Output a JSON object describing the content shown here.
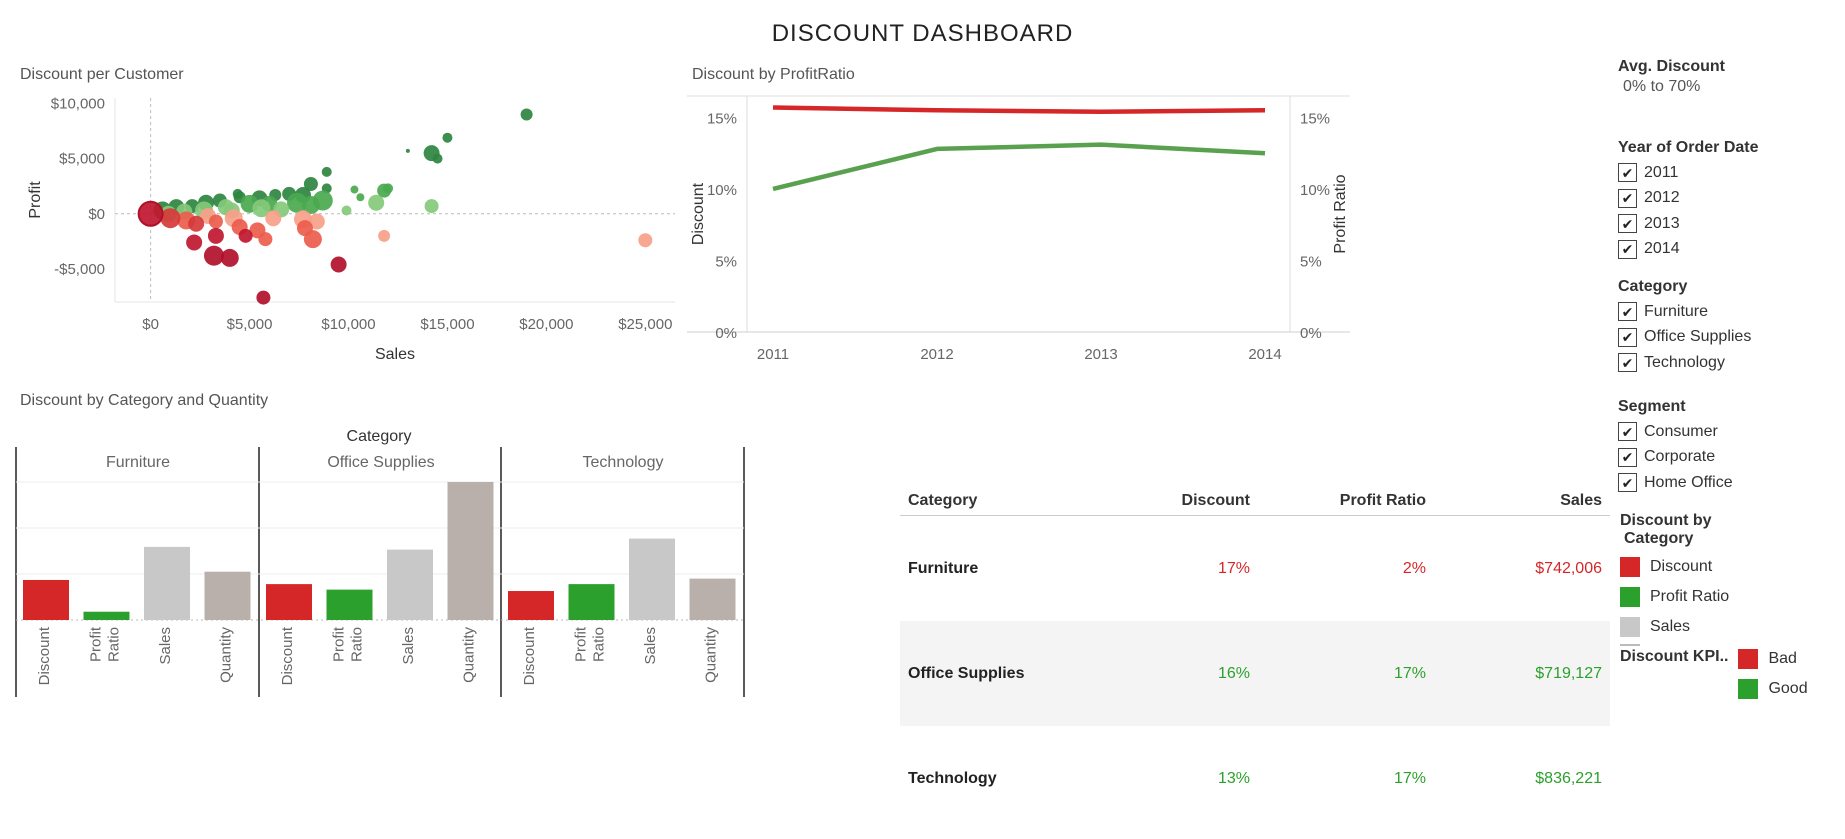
{
  "dashboard_title": "DISCOUNT DASHBOARD",
  "colors": {
    "bad": "#d62728",
    "good": "#2ca02c",
    "sales": "#c8c8c8",
    "quantity": "#bab0ab",
    "profit_line": "#59a14f",
    "discount_line": "#d62728"
  },
  "filters": {
    "avg_discount": {
      "title": "Avg. Discount",
      "value": "0% to 70%"
    },
    "year": {
      "title": "Year of Order Date",
      "items": [
        "2011",
        "2012",
        "2013",
        "2014"
      ]
    },
    "category": {
      "title": "Category",
      "items": [
        "Furniture",
        "Office Supplies",
        "Technology"
      ]
    },
    "segment": {
      "title": "Segment",
      "items": [
        "Consumer",
        "Corporate",
        "Home Office"
      ]
    }
  },
  "legend_category": {
    "title_line1": "Discount by",
    "title_line2": "Category",
    "items": [
      {
        "label": "Discount",
        "color": "#d62728"
      },
      {
        "label": "Profit Ratio",
        "color": "#2ca02c"
      },
      {
        "label": "Sales",
        "color": "#c8c8c8"
      }
    ]
  },
  "legend_kpi": {
    "title": "Discount KPI..",
    "items": [
      {
        "label": "Bad",
        "color": "#d62728"
      },
      {
        "label": "Good",
        "color": "#2ca02c"
      }
    ]
  },
  "table": {
    "headers": [
      "Category",
      "Discount",
      "Profit Ratio",
      "Sales"
    ],
    "rows": [
      {
        "category": "Furniture",
        "discount": "17%",
        "profit_ratio": "2%",
        "sales": "$742,006",
        "kpi": "bad"
      },
      {
        "category": "Office Supplies",
        "discount": "16%",
        "profit_ratio": "17%",
        "sales": "$719,127",
        "kpi": "good"
      },
      {
        "category": "Technology",
        "discount": "13%",
        "profit_ratio": "17%",
        "sales": "$836,221",
        "kpi": "good"
      }
    ]
  },
  "chart_data": [
    {
      "id": "scatter",
      "type": "scatter",
      "title": "Discount  per Customer",
      "xlabel": "Sales",
      "ylabel": "Profit",
      "xlim": [
        -1800,
        26500
      ],
      "ylim": [
        -8000,
        10500
      ],
      "xticks": [
        0,
        5000,
        10000,
        15000,
        20000,
        25000
      ],
      "xtick_labels": [
        "$0",
        "$5,000",
        "$10,000",
        "$15,000",
        "$20,000",
        "$25,000"
      ],
      "yticks": [
        -5000,
        0,
        5000,
        10000
      ],
      "ytick_labels": [
        "-$5,000",
        "$0",
        "$5,000",
        "$10,000"
      ],
      "points": [
        {
          "x": 19000,
          "y": 9000,
          "s": 6,
          "c": "#2e8540"
        },
        {
          "x": 15000,
          "y": 6900,
          "s": 5,
          "c": "#2e8540"
        },
        {
          "x": 14200,
          "y": 5500,
          "s": 8,
          "c": "#2e8540"
        },
        {
          "x": 14500,
          "y": 5000,
          "s": 5,
          "c": "#2e8540"
        },
        {
          "x": 13000,
          "y": 5700,
          "s": 2,
          "c": "#2e8540"
        },
        {
          "x": 8900,
          "y": 3800,
          "s": 5,
          "c": "#2e8540"
        },
        {
          "x": 8100,
          "y": 2700,
          "s": 7,
          "c": "#2e8540"
        },
        {
          "x": 8900,
          "y": 2300,
          "s": 5,
          "c": "#2e8540"
        },
        {
          "x": 10300,
          "y": 2200,
          "s": 4,
          "c": "#4aa94f"
        },
        {
          "x": 11800,
          "y": 2100,
          "s": 7,
          "c": "#4aa94f"
        },
        {
          "x": 12000,
          "y": 2300,
          "s": 5,
          "c": "#4aa94f"
        },
        {
          "x": 10600,
          "y": 1500,
          "s": 4,
          "c": "#4aa94f"
        },
        {
          "x": 11400,
          "y": 1000,
          "s": 8,
          "c": "#84c97a"
        },
        {
          "x": 14200,
          "y": 700,
          "s": 7,
          "c": "#84c97a"
        },
        {
          "x": 9900,
          "y": 300,
          "s": 5,
          "c": "#84c97a"
        },
        {
          "x": 8700,
          "y": 1200,
          "s": 10,
          "c": "#4aa94f"
        },
        {
          "x": 7700,
          "y": 1700,
          "s": 8,
          "c": "#2e8540"
        },
        {
          "x": 7000,
          "y": 1800,
          "s": 7,
          "c": "#2e8540"
        },
        {
          "x": 6300,
          "y": 1700,
          "s": 6,
          "c": "#2e8540"
        },
        {
          "x": 5500,
          "y": 1400,
          "s": 8,
          "c": "#2e8540"
        },
        {
          "x": 4500,
          "y": 1500,
          "s": 6,
          "c": "#2e8540"
        },
        {
          "x": 4400,
          "y": 1800,
          "s": 5,
          "c": "#2e8540"
        },
        {
          "x": 3500,
          "y": 1200,
          "s": 7,
          "c": "#2e8540"
        },
        {
          "x": 2800,
          "y": 1000,
          "s": 8,
          "c": "#2e8540"
        },
        {
          "x": 2100,
          "y": 700,
          "s": 7,
          "c": "#2e8540"
        },
        {
          "x": 1300,
          "y": 600,
          "s": 8,
          "c": "#2e8540"
        },
        {
          "x": 600,
          "y": 300,
          "s": 9,
          "c": "#2e8540"
        },
        {
          "x": 5000,
          "y": 900,
          "s": 9,
          "c": "#4aa94f"
        },
        {
          "x": 6000,
          "y": 900,
          "s": 8,
          "c": "#4aa94f"
        },
        {
          "x": 7400,
          "y": 1000,
          "s": 10,
          "c": "#4aa94f"
        },
        {
          "x": 8100,
          "y": 800,
          "s": 9,
          "c": "#4aa94f"
        },
        {
          "x": 3800,
          "y": 600,
          "s": 8,
          "c": "#84c97a"
        },
        {
          "x": 2700,
          "y": 300,
          "s": 9,
          "c": "#84c97a"
        },
        {
          "x": 1700,
          "y": 200,
          "s": 8,
          "c": "#84c97a"
        },
        {
          "x": 4100,
          "y": 300,
          "s": 8,
          "c": "#84c97a"
        },
        {
          "x": 5600,
          "y": 500,
          "s": 9,
          "c": "#84c97a"
        },
        {
          "x": 6600,
          "y": 400,
          "s": 8,
          "c": "#84c97a"
        },
        {
          "x": 900,
          "y": 0,
          "s": 8,
          "c": "#84c97a"
        },
        {
          "x": 2900,
          "y": -200,
          "s": 8,
          "c": "#f7a08a"
        },
        {
          "x": 4200,
          "y": -400,
          "s": 9,
          "c": "#f7a08a"
        },
        {
          "x": 6200,
          "y": -400,
          "s": 8,
          "c": "#f7a08a"
        },
        {
          "x": 7700,
          "y": -500,
          "s": 9,
          "c": "#f7a08a"
        },
        {
          "x": 8400,
          "y": -700,
          "s": 8,
          "c": "#f7a08a"
        },
        {
          "x": 11800,
          "y": -2000,
          "s": 6,
          "c": "#f7a08a"
        },
        {
          "x": 25000,
          "y": -2400,
          "s": 7,
          "c": "#f7a08a"
        },
        {
          "x": 1800,
          "y": -600,
          "s": 9,
          "c": "#ec5c4c"
        },
        {
          "x": 3300,
          "y": -700,
          "s": 7,
          "c": "#ec5c4c"
        },
        {
          "x": 4500,
          "y": -1200,
          "s": 8,
          "c": "#ec5c4c"
        },
        {
          "x": 5400,
          "y": -1500,
          "s": 8,
          "c": "#ec5c4c"
        },
        {
          "x": 5800,
          "y": -2300,
          "s": 7,
          "c": "#ec5c4c"
        },
        {
          "x": 7800,
          "y": -1300,
          "s": 8,
          "c": "#ec5c4c"
        },
        {
          "x": 8200,
          "y": -2300,
          "s": 9,
          "c": "#ec5c4c"
        },
        {
          "x": 1000,
          "y": -400,
          "s": 10,
          "c": "#d63a3a"
        },
        {
          "x": 2300,
          "y": -900,
          "s": 8,
          "c": "#d63a3a"
        },
        {
          "x": 4800,
          "y": -2000,
          "s": 7,
          "c": "#c0172f"
        },
        {
          "x": 2200,
          "y": -2600,
          "s": 8,
          "c": "#c0172f"
        },
        {
          "x": 3300,
          "y": -2000,
          "s": 8,
          "c": "#c0172f"
        },
        {
          "x": 3200,
          "y": -3800,
          "s": 10,
          "c": "#b0102a"
        },
        {
          "x": 4000,
          "y": -4000,
          "s": 9,
          "c": "#b0102a"
        },
        {
          "x": 9500,
          "y": -4600,
          "s": 8,
          "c": "#b0102a"
        },
        {
          "x": 5700,
          "y": -7600,
          "s": 7,
          "c": "#b0102a"
        },
        {
          "x": 0,
          "y": 0,
          "s": 12,
          "c": "#c0172f"
        }
      ]
    },
    {
      "id": "line",
      "type": "line",
      "title": "Discount by ProfitRatio",
      "ylabel_left": "Discount",
      "ylabel_right": "Profit Ratio",
      "x": [
        "2011",
        "2012",
        "2013",
        "2014"
      ],
      "ylim": [
        0,
        0.165
      ],
      "yticks": [
        0,
        0.05,
        0.1,
        0.15
      ],
      "ytick_labels": [
        "0%",
        "5%",
        "10%",
        "15%"
      ],
      "series": [
        {
          "axis": "left",
          "color": "#d62728",
          "values": [
            0.157,
            0.155,
            0.154,
            0.155
          ]
        },
        {
          "axis": "right",
          "color": "#59a14f",
          "values": [
            0.1,
            0.128,
            0.131,
            0.125
          ]
        }
      ]
    },
    {
      "id": "bars",
      "type": "bar",
      "title": "Discount by Category and Quantity",
      "column_header": "Category",
      "groups": [
        "Furniture",
        "Office Supplies",
        "Technology"
      ],
      "measures": [
        "Discount",
        "Profit Ratio",
        "Sales",
        "Quantity"
      ],
      "measure_labels": [
        [
          "Discount"
        ],
        [
          "Profit",
          "Ratio"
        ],
        [
          "Sales"
        ],
        [
          "Quantity"
        ]
      ],
      "values": [
        [
          0.29,
          0.06,
          0.53,
          0.35
        ],
        [
          0.26,
          0.22,
          0.51,
          1.0
        ],
        [
          0.21,
          0.26,
          0.59,
          0.3
        ]
      ],
      "bar_colors": [
        "#d62728",
        "#2ca02c",
        "#c8c8c8",
        "#bab0ab"
      ]
    }
  ]
}
